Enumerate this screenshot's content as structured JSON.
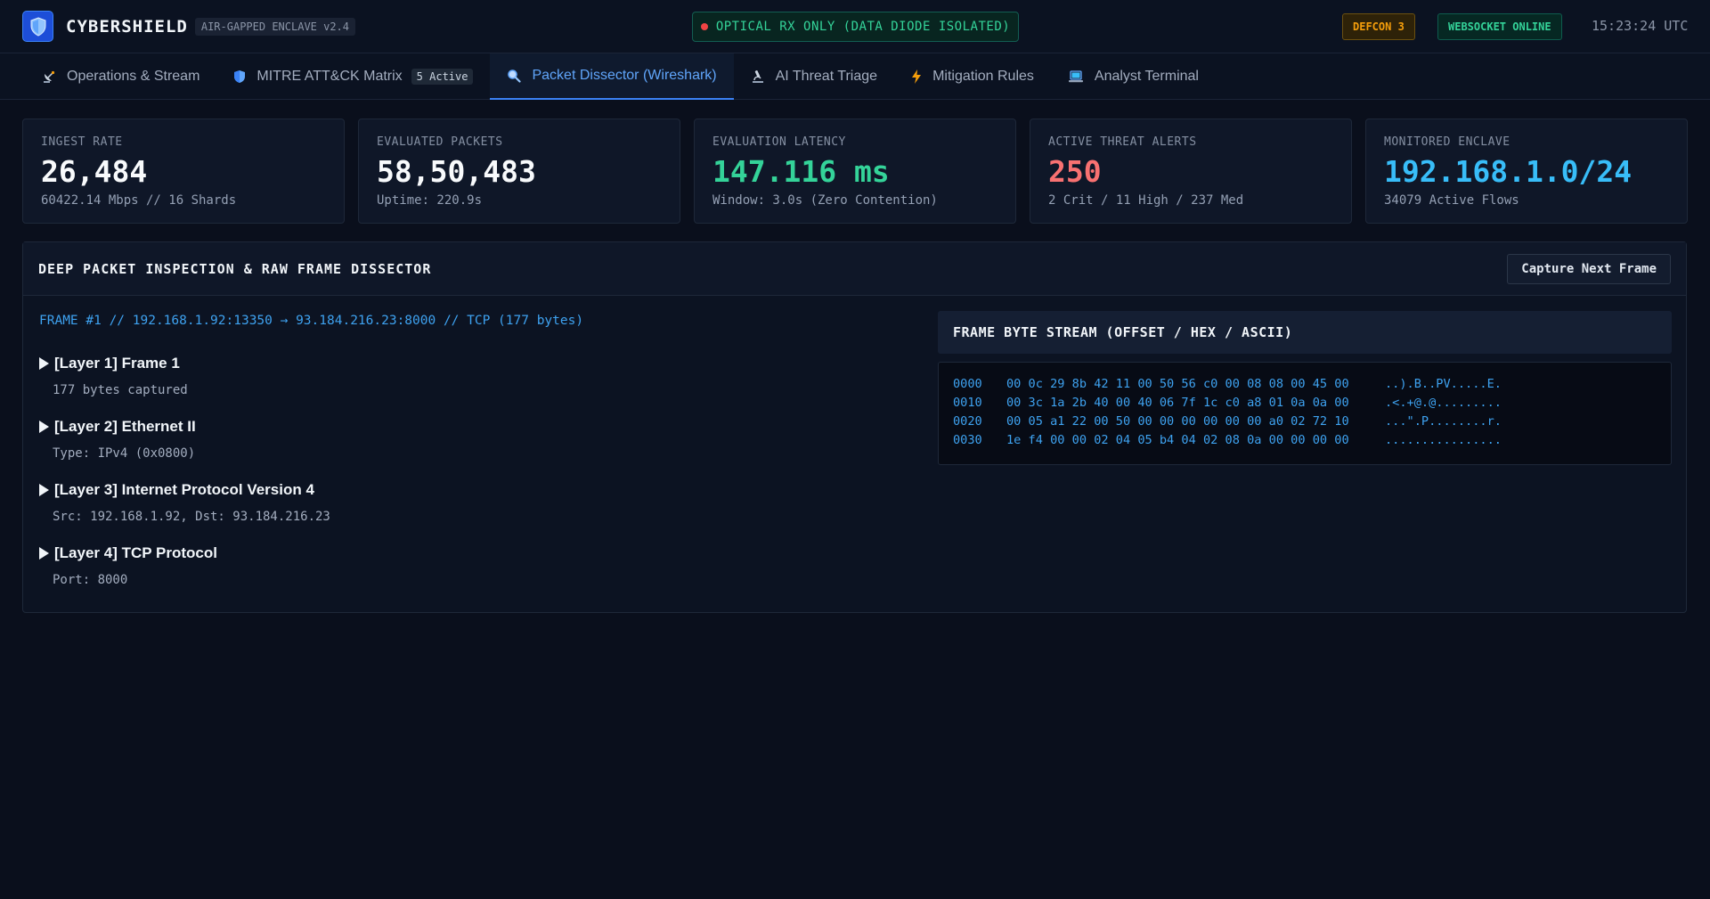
{
  "header": {
    "brand": "CYBERSHIELD",
    "version": "AIR-GAPPED ENCLAVE v2.4",
    "diode_status": "OPTICAL RX ONLY (DATA DIODE ISOLATED)",
    "defcon": "DEFCON 3",
    "websocket": "WEBSOCKET ONLINE",
    "clock": "15:23:24 UTC",
    "icons": {
      "logo": "shield-icon"
    }
  },
  "tabs": [
    {
      "label": "Operations & Stream",
      "icon": "satellite-dish-icon"
    },
    {
      "label": "MITRE ATT&CK Matrix",
      "icon": "shield-icon",
      "badge": "5 Active"
    },
    {
      "label": "Packet Dissector (Wireshark)",
      "icon": "magnifier-icon",
      "active": true
    },
    {
      "label": "AI Threat Triage",
      "icon": "microscope-icon"
    },
    {
      "label": "Mitigation Rules",
      "icon": "lightning-icon"
    },
    {
      "label": "Analyst Terminal",
      "icon": "laptop-icon"
    }
  ],
  "stats": [
    {
      "label": "INGEST RATE",
      "value": "26,484",
      "sub": "60422.14 Mbps // 16 Shards",
      "color": "#f8fafc"
    },
    {
      "label": "EVALUATED PACKETS",
      "value": "58,50,483",
      "sub": "Uptime: 220.9s",
      "color": "#f8fafc"
    },
    {
      "label": "EVALUATION LATENCY",
      "value": "147.116 ms",
      "sub": "Window: 3.0s (Zero Contention)",
      "color": "#34d399"
    },
    {
      "label": "ACTIVE THREAT ALERTS",
      "value": "250",
      "sub": "2 Crit / 11 High / 237 Med",
      "color": "#f87171"
    },
    {
      "label": "MONITORED ENCLAVE",
      "value": "192.168.1.0/24",
      "sub": "34079 Active Flows",
      "color": "#38bdf8"
    }
  ],
  "panel": {
    "title": "DEEP PACKET INSPECTION & RAW FRAME DISSECTOR",
    "capture_button": "Capture Next Frame",
    "frame_summary": "FRAME #1 // 192.168.1.92:13350 → 93.184.216.23:8000 // TCP (177 bytes)",
    "layers": [
      {
        "title": "[Layer 1] Frame 1",
        "detail": "177 bytes captured"
      },
      {
        "title": "[Layer 2] Ethernet II",
        "detail": "Type: IPv4 (0x0800)"
      },
      {
        "title": "[Layer 3] Internet Protocol Version 4",
        "detail": "Src: 192.168.1.92, Dst: 93.184.216.23"
      },
      {
        "title": "[Layer 4] TCP Protocol",
        "detail": "Port: 8000"
      }
    ],
    "bytes_title": "FRAME BYTE STREAM (OFFSET / HEX / ASCII)",
    "hex_rows": [
      {
        "offset": "0000",
        "hex": "00 0c 29 8b 42 11 00 50 56 c0 00 08 08 00 45 00",
        "ascii": "..).B..PV.....E."
      },
      {
        "offset": "0010",
        "hex": "00 3c 1a 2b 40 00 40 06 7f 1c c0 a8 01 0a 0a 00",
        "ascii": ".<.+@.@........."
      },
      {
        "offset": "0020",
        "hex": "00 05 a1 22 00 50 00 00 00 00 00 00 a0 02 72 10",
        "ascii": "...\".P........r."
      },
      {
        "offset": "0030",
        "hex": "1e f4 00 00 02 04 05 b4 04 02 08 0a 00 00 00 00",
        "ascii": "................"
      }
    ]
  }
}
